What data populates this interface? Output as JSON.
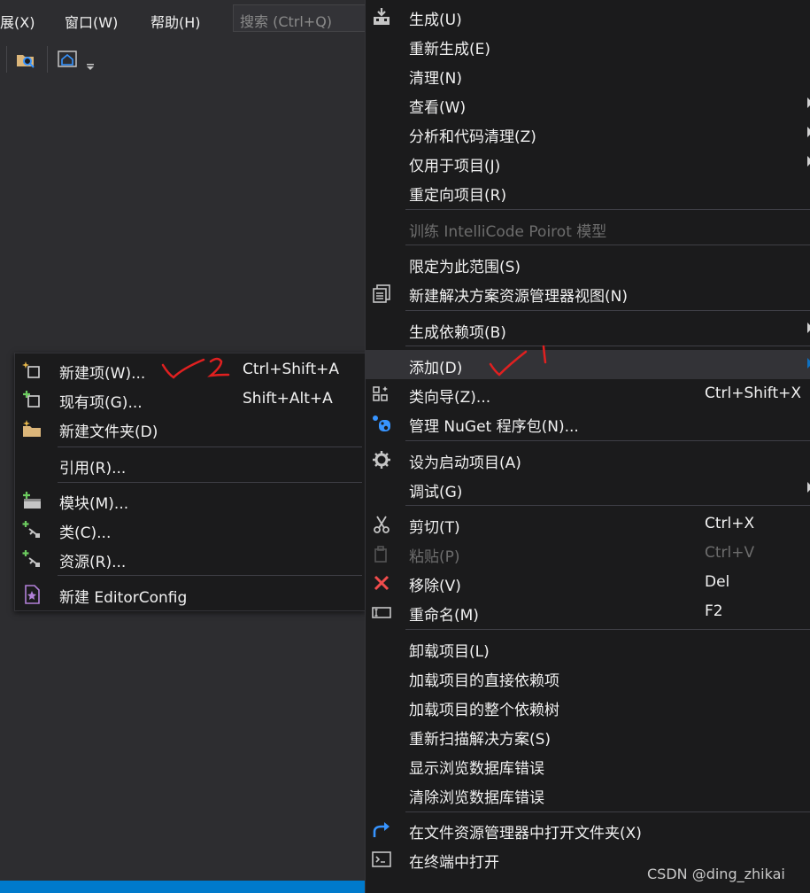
{
  "menubar": {
    "items": [
      {
        "label": "展(X)"
      },
      {
        "label": "窗口(W)"
      },
      {
        "label": "帮助(H)"
      }
    ],
    "search_placeholder": "搜索 (Ctrl+Q)"
  },
  "submenu": {
    "items": [
      {
        "label": "新建项(W)...",
        "shortcut": "Ctrl+Shift+A",
        "icon": "new-item-icon"
      },
      {
        "label": "现有项(G)...",
        "shortcut": "Shift+Alt+A",
        "icon": "existing-item-icon"
      },
      {
        "label": "新建文件夹(D)",
        "shortcut": "",
        "icon": "new-folder-icon"
      },
      {
        "label": "引用(R)...",
        "shortcut": "",
        "icon": ""
      },
      {
        "label": "模块(M)...",
        "shortcut": "",
        "icon": "module-icon"
      },
      {
        "label": "类(C)...",
        "shortcut": "",
        "icon": "class-icon"
      },
      {
        "label": "资源(R)...",
        "shortcut": "",
        "icon": "resource-icon"
      },
      {
        "label": "新建 EditorConfig",
        "shortcut": "",
        "icon": "editorconfig-icon"
      }
    ]
  },
  "context_menu": {
    "items": [
      {
        "label": "生成(U)",
        "icon": "build-icon"
      },
      {
        "label": "重新生成(E)"
      },
      {
        "label": "清理(N)"
      },
      {
        "label": "查看(W)",
        "submenu": true
      },
      {
        "label": "分析和代码清理(Z)",
        "submenu": true
      },
      {
        "label": "仅用于项目(J)",
        "submenu": true
      },
      {
        "label": "重定向项目(R)"
      },
      {
        "label": "训练 IntelliCode Poirot 模型",
        "disabled": true
      },
      {
        "label": "限定为此范围(S)"
      },
      {
        "label": "新建解决方案资源管理器视图(N)",
        "icon": "new-view-icon"
      },
      {
        "label": "生成依赖项(B)",
        "submenu": true
      },
      {
        "label": "添加(D)",
        "submenu": true,
        "highlighted": true
      },
      {
        "label": "类向导(Z)...",
        "shortcut": "Ctrl+Shift+X",
        "icon": "class-wizard-icon"
      },
      {
        "label": "管理 NuGet 程序包(N)...",
        "icon": "nuget-icon"
      },
      {
        "label": "设为启动项目(A)",
        "icon": "gear-icon"
      },
      {
        "label": "调试(G)",
        "submenu": true
      },
      {
        "label": "剪切(T)",
        "shortcut": "Ctrl+X",
        "icon": "cut-icon"
      },
      {
        "label": "粘贴(P)",
        "shortcut": "Ctrl+V",
        "icon": "paste-icon",
        "disabled": true
      },
      {
        "label": "移除(V)",
        "shortcut": "Del",
        "icon": "remove-icon"
      },
      {
        "label": "重命名(M)",
        "shortcut": "F2",
        "icon": "rename-icon"
      },
      {
        "label": "卸载项目(L)"
      },
      {
        "label": "加载项目的直接依赖项"
      },
      {
        "label": "加载项目的整个依赖树"
      },
      {
        "label": "重新扫描解决方案(S)"
      },
      {
        "label": "显示浏览数据库错误"
      },
      {
        "label": "清除浏览数据库错误"
      },
      {
        "label": "在文件资源管理器中打开文件夹(X)",
        "icon": "open-folder-icon"
      },
      {
        "label": "在终端中打开",
        "icon": "terminal-icon"
      }
    ]
  },
  "watermark": "CSDN @ding_zhikai",
  "colors": {
    "menu_bg": "#1b1b1c",
    "ide_bg": "#2d2d30",
    "highlight": "#333337",
    "accent": "#007acc",
    "annotation": "#e02020"
  }
}
